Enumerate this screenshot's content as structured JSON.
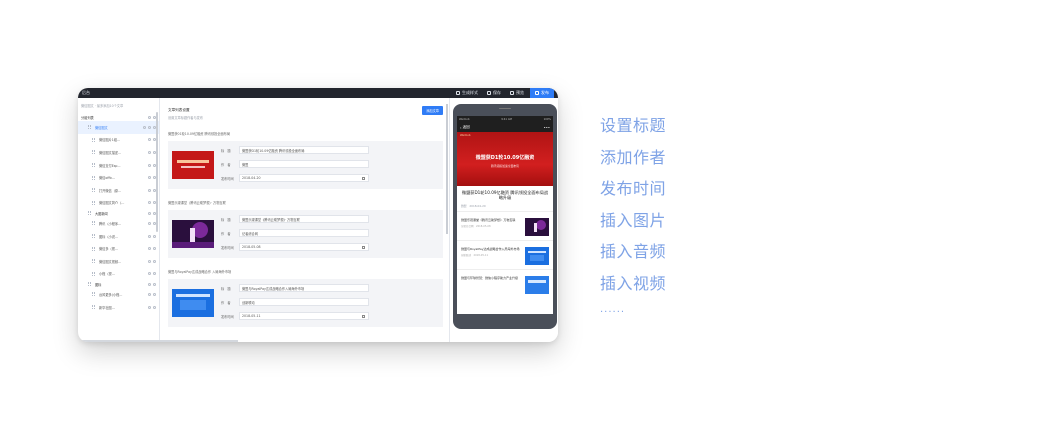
{
  "colors": {
    "accent": "#2f7cf6",
    "feature_text": "#7fa3e6",
    "red_banner": "#c21818"
  },
  "topbar": {
    "app_name": "后台",
    "actions": [
      {
        "label": "生成样式",
        "icon": "brush-icon"
      },
      {
        "label": "保存",
        "icon": "save-icon"
      },
      {
        "label": "预览",
        "icon": "eye-icon"
      }
    ],
    "publish_label": "发布"
  },
  "sidebar": {
    "header": "微信图文 · 最多添加10个文章",
    "groups": [
      {
        "label": "分组列表"
      },
      {
        "label": "大图新闻"
      },
      {
        "label": "图标"
      }
    ],
    "items": [
      "微信图文",
      "微信图片1组...",
      "微信图文描述...",
      "微信支付Esp...",
      "微信offic...",
      "打开微信（原...",
      "微信图文简介（...",
      "腾讯（小程序...",
      "图标（小说...",
      "微信多（视...",
      "微信图文视频...",
      "小程（视...",
      "台风更多(小程...",
      "新华社图..."
    ]
  },
  "editor": {
    "title": "文章列表设置",
    "subtitle": "设置文章标题作者与发布",
    "add_button": "添加文章",
    "sections": [
      {
        "label": "微盟获01轮10.09亿融资 腾讯领投全面布局",
        "title_key": "标　题",
        "title_value": "微盟获D1轮10.09亿融资 腾讯领投全面布局",
        "author_key": "作　者",
        "author_value": "微盟",
        "date_key": "发布时间",
        "date_value": "2018-04-20"
      },
      {
        "label": "微盟乐观课堂（腾讯云助梦想）· 万物互联",
        "title_key": "标　题",
        "title_value": "微盟乐观课堂《腾讯云助梦想》· 万物互联",
        "author_key": "作　者",
        "author_value": "记者综合网",
        "date_key": "发布时间",
        "date_value": "2018-05-08"
      },
      {
        "label": "微盟与RoyalPay达成战略合作 入局海外市场",
        "title_key": "标　题",
        "title_value": "微盟与RoyalPay达成战略合作入局海外市场",
        "author_key": "作　者",
        "author_value": "创新联动",
        "date_key": "发布时间",
        "date_value": "2018-05-11"
      }
    ]
  },
  "phone": {
    "status_left": "Weimob",
    "status_time": "9:41 AM",
    "status_right": "100%",
    "nav_back": "返回",
    "nav_more": "•••",
    "hero_brand": "Weimob",
    "hero_title": "微盟获D1轮10.09亿融资",
    "hero_subtitle": "腾讯领投加速全面布局",
    "article_title": "微盟获D1轮10.09亿融资 腾讯领投全面布局战略升级",
    "article_meta": "微盟　2018-04-20",
    "list": [
      {
        "title": "微盟乐观课堂《腾讯云助梦想》· 万物互联",
        "meta": "记者综合网　2018-05-08"
      },
      {
        "title": "微盟与RoyalPay达成战略合作入局海外市场",
        "meta": "创新联动　2018-05-11"
      },
      {
        "title": "微盟与环球智慧：微信小程序助力产业升级",
        "meta": ""
      }
    ]
  },
  "features": {
    "items": [
      "设置标题",
      "添加作者",
      "发布时间",
      "插入图片",
      "插入音频",
      "插入视频"
    ],
    "more": "......"
  }
}
